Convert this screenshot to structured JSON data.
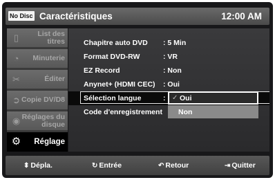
{
  "header": {
    "badge": "No Disc",
    "title": "Caractéristiques",
    "time": "12:00 AM"
  },
  "sidebar": {
    "items": [
      {
        "label": "List des titres",
        "icon": "list-titles-icon",
        "active": false
      },
      {
        "label": "Minuterie",
        "icon": "timer-icon",
        "active": false
      },
      {
        "label": "Éditer",
        "icon": "scissors-icon",
        "active": false
      },
      {
        "label": "Copie DV/D8",
        "icon": "copy-icon",
        "active": false
      },
      {
        "label": "Réglages du disque",
        "icon": "disc-icon",
        "active": false
      },
      {
        "label": "Réglage",
        "icon": "gear-icon",
        "active": true
      }
    ]
  },
  "settings": {
    "rows": [
      {
        "label": "Chapitre auto DVD",
        "value": ": 5 Min"
      },
      {
        "label": "Format DVD-RW",
        "value": ": VR"
      },
      {
        "label": "EZ Record",
        "value": ": Non"
      },
      {
        "label": "Anynet+ (HDMI CEC)",
        "value": ": Oui"
      },
      {
        "label": "Sélection langue",
        "value": ":"
      },
      {
        "label": "Code d'enregistrement",
        "value": ""
      }
    ],
    "dropdown": {
      "options": [
        "Oui",
        "Non"
      ],
      "selected": "Oui"
    }
  },
  "footer": {
    "move": "Dépla.",
    "enter": "Entrée",
    "back": "Retour",
    "quit": "Quitter"
  },
  "colors": {
    "background": "#18181a",
    "sidebar_item": "#636363",
    "active_item": "#000000",
    "text": "#ffffff"
  }
}
